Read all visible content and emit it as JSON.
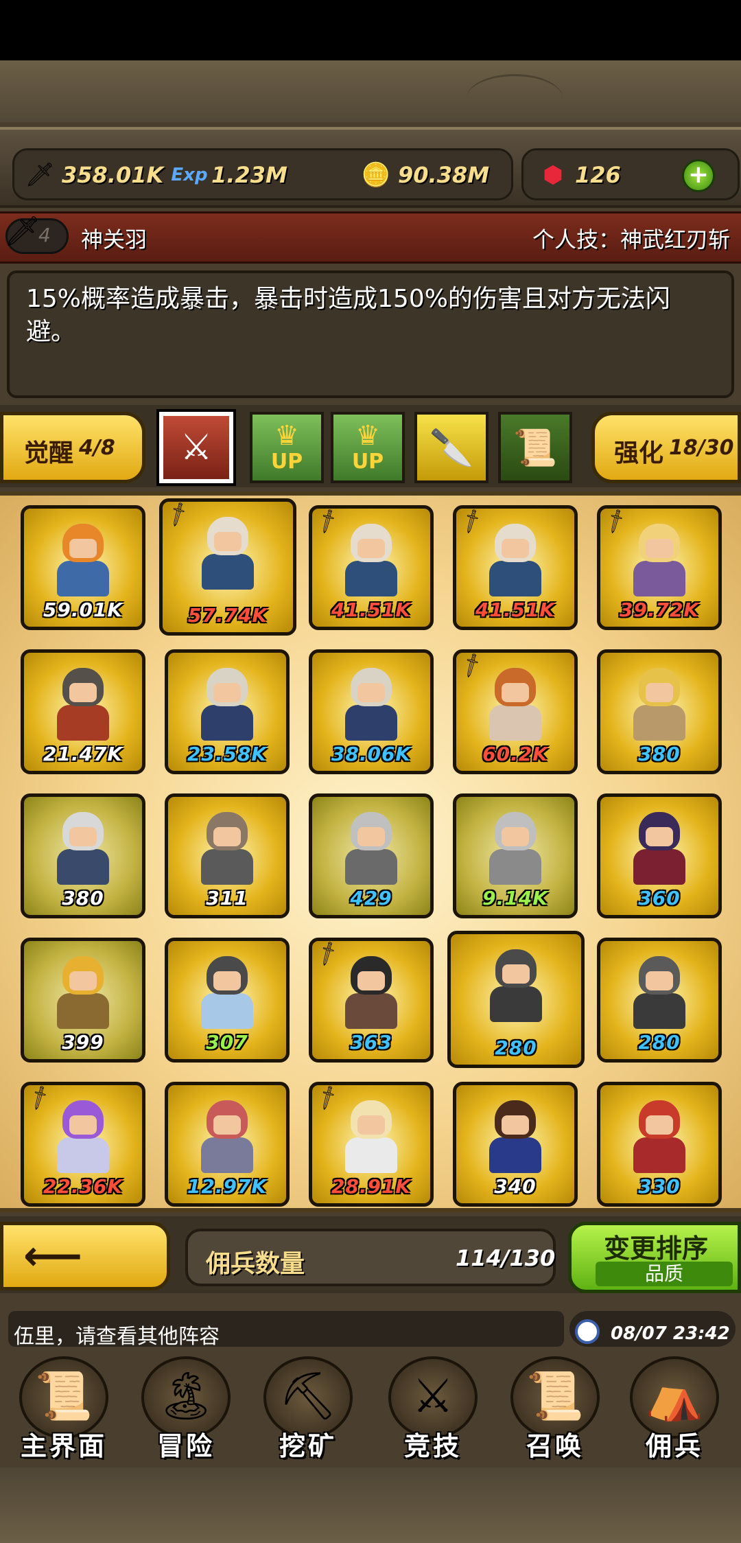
{
  "resources": {
    "attack": "358.01K",
    "exp": "1.23M",
    "gold": "90.38M",
    "gems": "126",
    "exp_icon_text": "Exp"
  },
  "skill": {
    "level": "4",
    "hero_name": "神关羽",
    "skill_label": "个人技：神武红刃斩",
    "description": "15%概率造成暴击，暴击时造成150%的伤害且对方无法闪避。"
  },
  "awaken": {
    "label": "觉醒",
    "value": "4/8"
  },
  "strengthen": {
    "label": "强化",
    "value": "18/30"
  },
  "tabs": [
    {
      "icon": "crossed-swords-icon"
    },
    {
      "icon": "crown-up-icon",
      "text": "UP"
    },
    {
      "icon": "crown-up-icon",
      "text": "UP"
    },
    {
      "icon": "glaive-icon"
    },
    {
      "icon": "scroll-icon"
    }
  ],
  "mercenaries": [
    {
      "power": "59.01K",
      "color": "#ffffff",
      "hair": "#e8862a",
      "body": "#3f6aa8"
    },
    {
      "power": "57.74K",
      "color": "#ff4e3a",
      "hair": "#e6dccd",
      "body": "#2d4f7a"
    },
    {
      "power": "41.51K",
      "color": "#ff4e3a",
      "hair": "#e6dccd",
      "body": "#2d4f7a"
    },
    {
      "power": "41.51K",
      "color": "#ff4e3a",
      "hair": "#e6dccd",
      "body": "#2d4f7a"
    },
    {
      "power": "39.72K",
      "color": "#ff4e3a",
      "hair": "#f1d27a",
      "body": "#7a5a9a"
    },
    {
      "power": "21.47K",
      "color": "#ffffff",
      "hair": "#55504a",
      "body": "#a63c24"
    },
    {
      "power": "23.58K",
      "color": "#3fc2ff",
      "hair": "#d9d3c6",
      "body": "#2e3f6c"
    },
    {
      "power": "38.06K",
      "color": "#3fc2ff",
      "hair": "#d9d3c6",
      "body": "#2e3f6c"
    },
    {
      "power": "60.2K",
      "color": "#ff4e3a",
      "hair": "#c9692a",
      "body": "#d9c5b0"
    },
    {
      "power": "380",
      "color": "#3fc2ff",
      "hair": "#e6c24a",
      "body": "#b89a6a"
    },
    {
      "power": "380",
      "color": "#ffffff",
      "hair": "#d8d8d8",
      "body": "#3a4a6a"
    },
    {
      "power": "311",
      "color": "#ffffff",
      "hair": "#8a7766",
      "body": "#5a5a5a"
    },
    {
      "power": "429",
      "color": "#3fc2ff",
      "hair": "#c0c0c0",
      "body": "#6a6a6a"
    },
    {
      "power": "9.14K",
      "color": "#9af14a",
      "hair": "#bfbfbf",
      "body": "#8a8a8a"
    },
    {
      "power": "360",
      "color": "#3fc2ff",
      "hair": "#3a2a5a",
      "body": "#7a2030"
    },
    {
      "power": "399",
      "color": "#ffffff",
      "hair": "#e8b030",
      "body": "#8a6a30"
    },
    {
      "power": "307",
      "color": "#9af14a",
      "hair": "#4a4a4a",
      "body": "#a8c8e8"
    },
    {
      "power": "363",
      "color": "#3fc2ff",
      "hair": "#2a2a2a",
      "body": "#6a4a3a"
    },
    {
      "power": "280",
      "color": "#3fc2ff",
      "hair": "#4a4a4a",
      "body": "#3a3a3a"
    },
    {
      "power": "280",
      "color": "#3fc2ff",
      "hair": "#5a5a5a",
      "body": "#3a3a3a"
    },
    {
      "power": "22.36K",
      "color": "#ff4e3a",
      "hair": "#9a5ad8",
      "body": "#c8c8e8"
    },
    {
      "power": "12.97K",
      "color": "#3fc2ff",
      "hair": "#c85a5a",
      "body": "#7a7a9a"
    },
    {
      "power": "28.91K",
      "color": "#ff4e3a",
      "hair": "#f2e2b0",
      "body": "#eaeaea"
    },
    {
      "power": "340",
      "color": "#ffffff",
      "hair": "#4a2a1a",
      "body": "#2a3a8a"
    },
    {
      "power": "330",
      "color": "#3fc2ff",
      "hair": "#c83a2a",
      "body": "#a82a2a"
    }
  ],
  "bottom": {
    "count_label": "佣兵数量",
    "count_value": "114/130",
    "sort_title": "变更排序",
    "sort_sub": "品质"
  },
  "message": {
    "text": "伍里，请查看其他阵容",
    "time": "08/07 23:42"
  },
  "nav": [
    {
      "label": "主界面",
      "glyph": "📜"
    },
    {
      "label": "冒险",
      "glyph": "🏝"
    },
    {
      "label": "挖矿",
      "glyph": "⛏"
    },
    {
      "label": "竞技",
      "glyph": "⚔"
    },
    {
      "label": "召唤",
      "glyph": "📜"
    },
    {
      "label": "佣兵",
      "glyph": "⛺"
    }
  ]
}
